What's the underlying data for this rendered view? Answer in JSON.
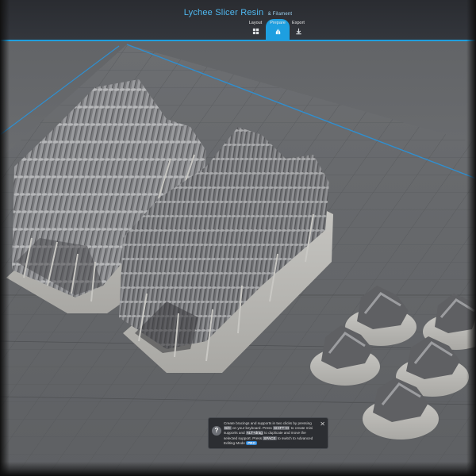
{
  "app": {
    "title": "Lychee Slicer Resin",
    "subtitle": "& Filament"
  },
  "tabs": [
    {
      "label": "Layout",
      "icon": "layout-icon",
      "active": false
    },
    {
      "label": "Prepare",
      "icon": "support-icon",
      "active": true
    },
    {
      "label": "Export",
      "icon": "export-icon",
      "active": false
    }
  ],
  "colors": {
    "accent": "#1e9fe0",
    "build_plate": "#6f7174",
    "grid_line": "#3a9ad8",
    "model": "#8e8f92"
  },
  "hint": {
    "t1": "Create bracings and supports in two clicks by pressing",
    "k1": "B/D",
    "t2": "on your keyboard. Press",
    "k2": "SHIFT+D",
    "t3": "to create mini supports and",
    "k3": "ALT+drag",
    "t4": "to duplicate and move the selected support. Press",
    "k4": "SPACE",
    "t5": "to switch to Advanced Editing Mode",
    "pro": "PRO",
    "close": "✕",
    "help": "?"
  }
}
